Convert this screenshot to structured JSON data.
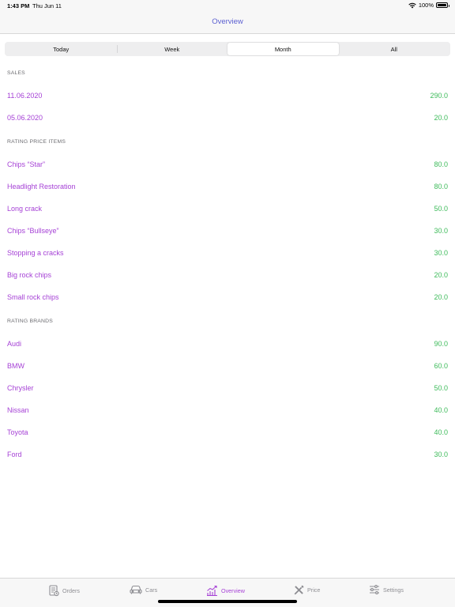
{
  "status": {
    "time": "1:43 PM",
    "date": "Thu Jun 11",
    "battery": "100%"
  },
  "nav": {
    "title": "Overview"
  },
  "segments": [
    {
      "label": "Today"
    },
    {
      "label": "Week"
    },
    {
      "label": "Month"
    },
    {
      "label": "All"
    }
  ],
  "selected_segment": "Month",
  "sections": {
    "sales": {
      "title": "SALES",
      "rows": [
        {
          "label": "11.06.2020",
          "value": "290.0"
        },
        {
          "label": "05.06.2020",
          "value": "20.0"
        }
      ]
    },
    "price_items": {
      "title": "RATING PRICE ITEMS",
      "rows": [
        {
          "label": "Chips “Star”",
          "value": "80.0"
        },
        {
          "label": "Headlight Restoration",
          "value": "80.0"
        },
        {
          "label": "Long crack",
          "value": "50.0"
        },
        {
          "label": "Chips “Bullseye”",
          "value": "30.0"
        },
        {
          "label": "Stopping a cracks",
          "value": "30.0"
        },
        {
          "label": "Big rock chips",
          "value": "20.0"
        },
        {
          "label": "Small rock chips",
          "value": "20.0"
        }
      ]
    },
    "brands": {
      "title": "RATING BRANDS",
      "rows": [
        {
          "label": "Audi",
          "value": "90.0"
        },
        {
          "label": "BMW",
          "value": "60.0"
        },
        {
          "label": "Chrysler",
          "value": "50.0"
        },
        {
          "label": "Nissan",
          "value": "40.0"
        },
        {
          "label": "Toyota",
          "value": "40.0"
        },
        {
          "label": "Ford",
          "value": "30.0"
        }
      ]
    }
  },
  "tabs": [
    {
      "label": "Orders",
      "icon": "orders-icon"
    },
    {
      "label": "Cars",
      "icon": "car-icon"
    },
    {
      "label": "Overview",
      "icon": "chart-icon"
    },
    {
      "label": "Price",
      "icon": "tools-icon"
    },
    {
      "label": "Settings",
      "icon": "sliders-icon"
    }
  ],
  "selected_tab": "Overview",
  "colors": {
    "accent": "#a642d6",
    "title": "#5b5fd1",
    "value": "#3dbb5a",
    "inactive": "#8e8e93"
  }
}
